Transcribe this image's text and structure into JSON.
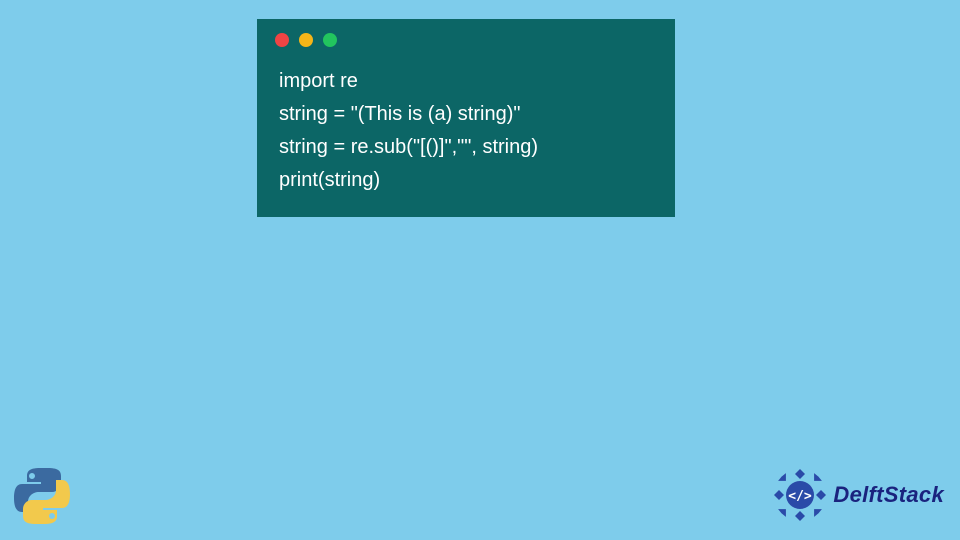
{
  "window": {
    "dots": [
      "red",
      "yellow",
      "green"
    ]
  },
  "code": {
    "lines": [
      "import re",
      "string = \"(This is (a) string)\"",
      "string = re.sub(\"[()]\",\"\", string)",
      "print(string)"
    ]
  },
  "branding": {
    "python_icon": "python-logo",
    "site_name": "DelftStack",
    "site_badge": "code-tag-icon"
  },
  "colors": {
    "background": "#7ecceb",
    "code_bg": "#0c6666",
    "code_fg": "#ffffff",
    "brand_text": "#1a237e"
  }
}
